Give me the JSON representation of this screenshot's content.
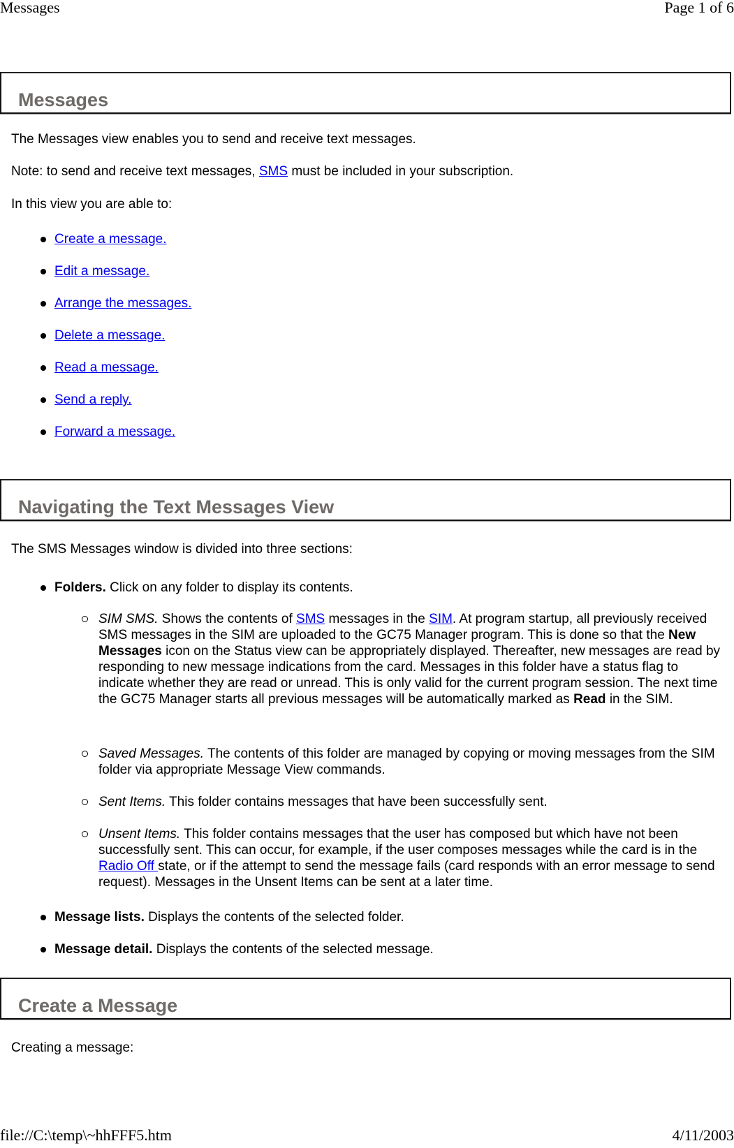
{
  "print_header": {
    "title": "Messages",
    "page": "Page 1 of 6"
  },
  "print_footer": {
    "path": "file://C:\\temp\\~hhFFF5.htm",
    "date": "4/11/2003"
  },
  "sections": {
    "messages": {
      "heading": "Messages",
      "intro": "The Messages view enables you to send and receive text messages.",
      "note_before": "Note: to send and receive text messages, ",
      "note_link": "SMS",
      "note_after": " must be included in your subscription.",
      "able_to": "In this view you are able to:",
      "links": [
        "Create a message.",
        "Edit a message.",
        "Arrange the messages.",
        "Delete a message.",
        "Read a message.",
        "Send a reply.",
        "Forward a message."
      ]
    },
    "navigating": {
      "heading": "Navigating the Text Messages View",
      "intro": "The SMS Messages window is divided into three sections:",
      "folders_label": "Folders.",
      "folders_text": " Click on any folder to display its contents.",
      "sim_sms": {
        "label": "SIM SMS.",
        "t1": " Shows the contents of ",
        "link1": "SMS",
        "t2": " messages in the ",
        "link2": "SIM",
        "t3": ". At program startup, all previously received SMS messages in the SIM are uploaded to the GC75 Manager program. This is done so that the ",
        "bold1": "New Messages",
        "t4": " icon on the Status view can be appropriately displayed. Thereafter, new messages are read by responding to new message indications from the card. Messages in this folder have a status flag to indicate whether they are read or unread. This is only valid for the current program session. The next time the GC75 Manager starts all previous messages will be automatically marked as ",
        "bold2": "Read",
        "t5": " in the SIM."
      },
      "saved": {
        "label": "Saved Messages.",
        "text": " The contents of this folder are managed by copying or moving messages from the SIM folder via appropriate Message View commands."
      },
      "sent": {
        "label": "Sent Items.",
        "text": " This folder contains messages that have been successfully sent."
      },
      "unsent": {
        "label": "Unsent Items.",
        "t1": " This folder contains messages that the user has composed but which have not been successfully sent. This can occur, for example, if the user composes messages while the card is in the ",
        "link": "Radio Off ",
        "t2": "state, or if the attempt to send the message fails (card responds with an error message to send request). Messages in the Unsent Items can be sent at a later time."
      },
      "lists_label": "Message lists.",
      "lists_text": " Displays the contents of the selected folder.",
      "detail_label": "Message detail.",
      "detail_text": " Displays the contents of the selected message."
    },
    "create": {
      "heading": "Create a Message",
      "intro": "Creating a message:"
    }
  }
}
